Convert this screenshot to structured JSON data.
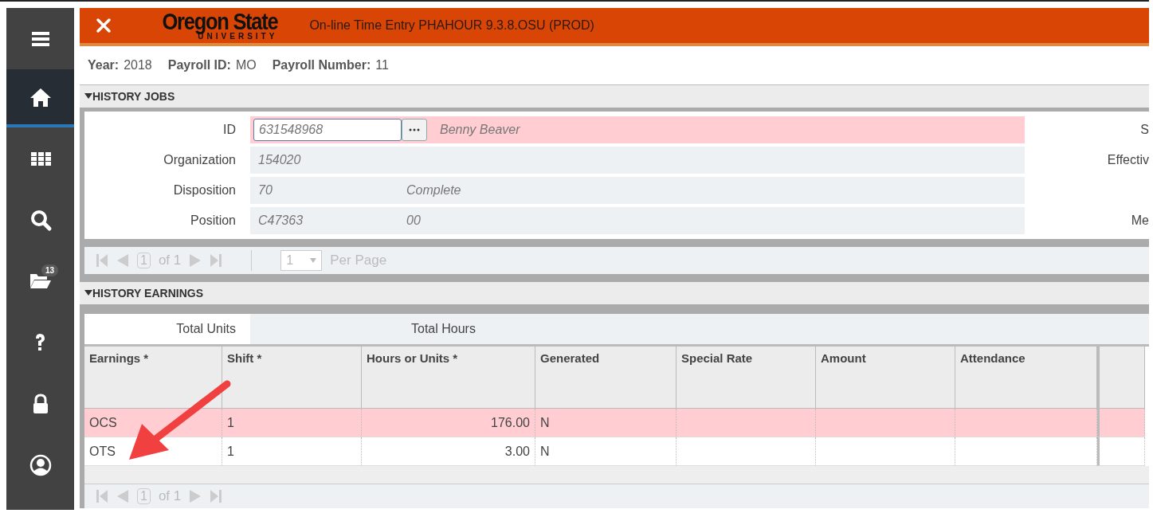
{
  "sidebar": {
    "items": [
      {
        "kind": "menu",
        "selected": false
      },
      {
        "kind": "home",
        "selected": true
      },
      {
        "kind": "apps",
        "selected": false
      },
      {
        "kind": "search",
        "selected": false
      },
      {
        "kind": "recent",
        "selected": false,
        "badge": "13"
      },
      {
        "kind": "help",
        "selected": false
      },
      {
        "kind": "lock",
        "selected": false
      },
      {
        "kind": "user",
        "selected": false
      }
    ]
  },
  "header": {
    "logo_top": "Oregon State",
    "logo_bottom": "UNIVERSITY",
    "title": "On-line Time Entry PHAHOUR 9.3.8.OSU (PROD)"
  },
  "info": [
    {
      "label": "Year:",
      "value": "2018"
    },
    {
      "label": "Payroll ID:",
      "value": "MO"
    },
    {
      "label": "Payroll Number:",
      "value": "11"
    }
  ],
  "history_jobs": {
    "title": "HISTORY JOBS",
    "expanded": true,
    "fields": [
      {
        "label": "ID",
        "kind": "lookup",
        "value": "631548968",
        "description": "Benny Beaver",
        "error": true,
        "side_label": "S"
      },
      {
        "label": "Organization",
        "kind": "text",
        "value": "154020",
        "error": false,
        "side_label": "Effectiv"
      },
      {
        "label": "Disposition",
        "kind": "text",
        "value": "70",
        "description": "Complete",
        "error": false
      },
      {
        "label": "Position",
        "kind": "text",
        "value": "C47363",
        "description": "00",
        "error": false,
        "side_label": "Me"
      }
    ],
    "pager": {
      "page": "1",
      "of": "of 1",
      "per_page": "1",
      "per_page_label": "Per Page"
    }
  },
  "history_earnings": {
    "title": "HISTORY EARNINGS",
    "expanded": true,
    "totals": [
      {
        "label": "Total Units"
      },
      {
        "label": "Total Hours"
      }
    ],
    "columns": [
      "Earnings *",
      "Shift *",
      "Hours or Units *",
      "Generated",
      "Special Rate",
      "Amount",
      "Attendance"
    ],
    "rows": [
      {
        "selected": true,
        "cells": [
          "OCS",
          "1",
          "176.00",
          "N",
          "",
          "",
          ""
        ]
      },
      {
        "selected": false,
        "cells": [
          "OTS",
          "1",
          "3.00",
          "N",
          "",
          "",
          ""
        ]
      }
    ],
    "pager": {
      "page": "1",
      "of": "of 1"
    }
  }
}
